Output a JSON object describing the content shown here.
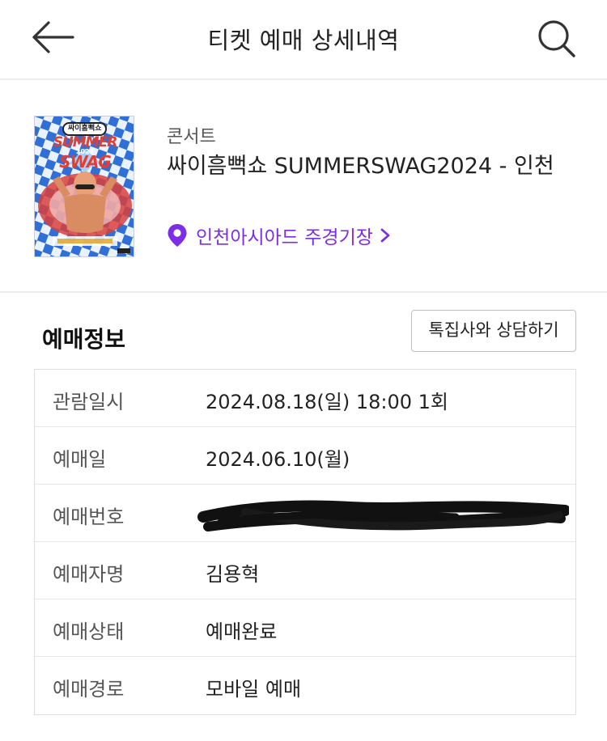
{
  "header": {
    "title": "티켓 예매 상세내역",
    "back_icon": "arrow-left-icon",
    "search_icon": "search-icon"
  },
  "event": {
    "category": "콘서트",
    "name": "싸이흠뻑쇼 SUMMERSWAG2024 - 인천",
    "venue": "인천아시아드 주경기장",
    "poster": {
      "badge": "싸이흠뻑쇼",
      "headline_1": "SUMMER",
      "year": "2024",
      "headline_2": "SWAG"
    },
    "accent_color": "#7c2ee6"
  },
  "booking": {
    "section_title": "예매정보",
    "consult_button": "톡집사와 상담하기",
    "rows": [
      {
        "label": "관람일시",
        "value": "2024.08.18(일) 18:00 1회"
      },
      {
        "label": "예매일",
        "value": "2024.06.10(월)"
      },
      {
        "label": "예매번호",
        "value": ""
      },
      {
        "label": "예매자명",
        "value": "김용혁"
      },
      {
        "label": "예매상태",
        "value": "예매완료"
      },
      {
        "label": "예매경로",
        "value": "모바일 예매"
      }
    ]
  }
}
